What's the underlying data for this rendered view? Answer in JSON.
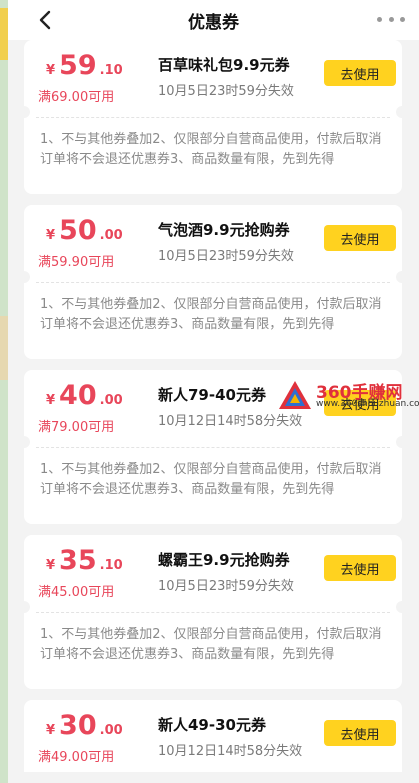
{
  "header": {
    "title": "优惠券"
  },
  "coupons": [
    {
      "currency": "¥",
      "amount_int": "59",
      "amount_dec": ".10",
      "condition": "满69.00可用",
      "name": "百草味礼包9.9元券",
      "expiry": "10月5日23时59分失效",
      "button": "去使用",
      "desc": "1、不与其他券叠加2、仅限部分自营商品使用，付款后取消订单将不会退还优惠券3、商品数量有限，先到先得"
    },
    {
      "currency": "¥",
      "amount_int": "50",
      "amount_dec": ".00",
      "condition": "满59.90可用",
      "name": "气泡酒9.9元抢购券",
      "expiry": "10月5日23时59分失效",
      "button": "去使用",
      "desc": "1、不与其他券叠加2、仅限部分自营商品使用，付款后取消订单将不会退还优惠券3、商品数量有限，先到先得"
    },
    {
      "currency": "¥",
      "amount_int": "40",
      "amount_dec": ".00",
      "condition": "满79.00可用",
      "name": "新人79-40元券",
      "expiry": "10月12日14时58分失效",
      "button": "去使用",
      "desc": "1、不与其他券叠加2、仅限部分自营商品使用，付款后取消订单将不会退还优惠券3、商品数量有限，先到先得"
    },
    {
      "currency": "¥",
      "amount_int": "35",
      "amount_dec": ".10",
      "condition": "满45.00可用",
      "name": "螺霸王9.9元抢购券",
      "expiry": "10月5日23时59分失效",
      "button": "去使用",
      "desc": "1、不与其他券叠加2、仅限部分自营商品使用，付款后取消订单将不会退还优惠券3、商品数量有限，先到先得"
    },
    {
      "currency": "¥",
      "amount_int": "30",
      "amount_dec": ".00",
      "condition": "满49.00可用",
      "name": "新人49-30元券",
      "expiry": "10月12日14时58分失效",
      "button": "去使用",
      "desc": ""
    }
  ],
  "watermark": {
    "text": "360手赚网",
    "url": "www.360shouzhuan.com"
  },
  "colors": {
    "price": "#e8465a",
    "button": "#ffd21f",
    "background": "#f3f3f3"
  }
}
